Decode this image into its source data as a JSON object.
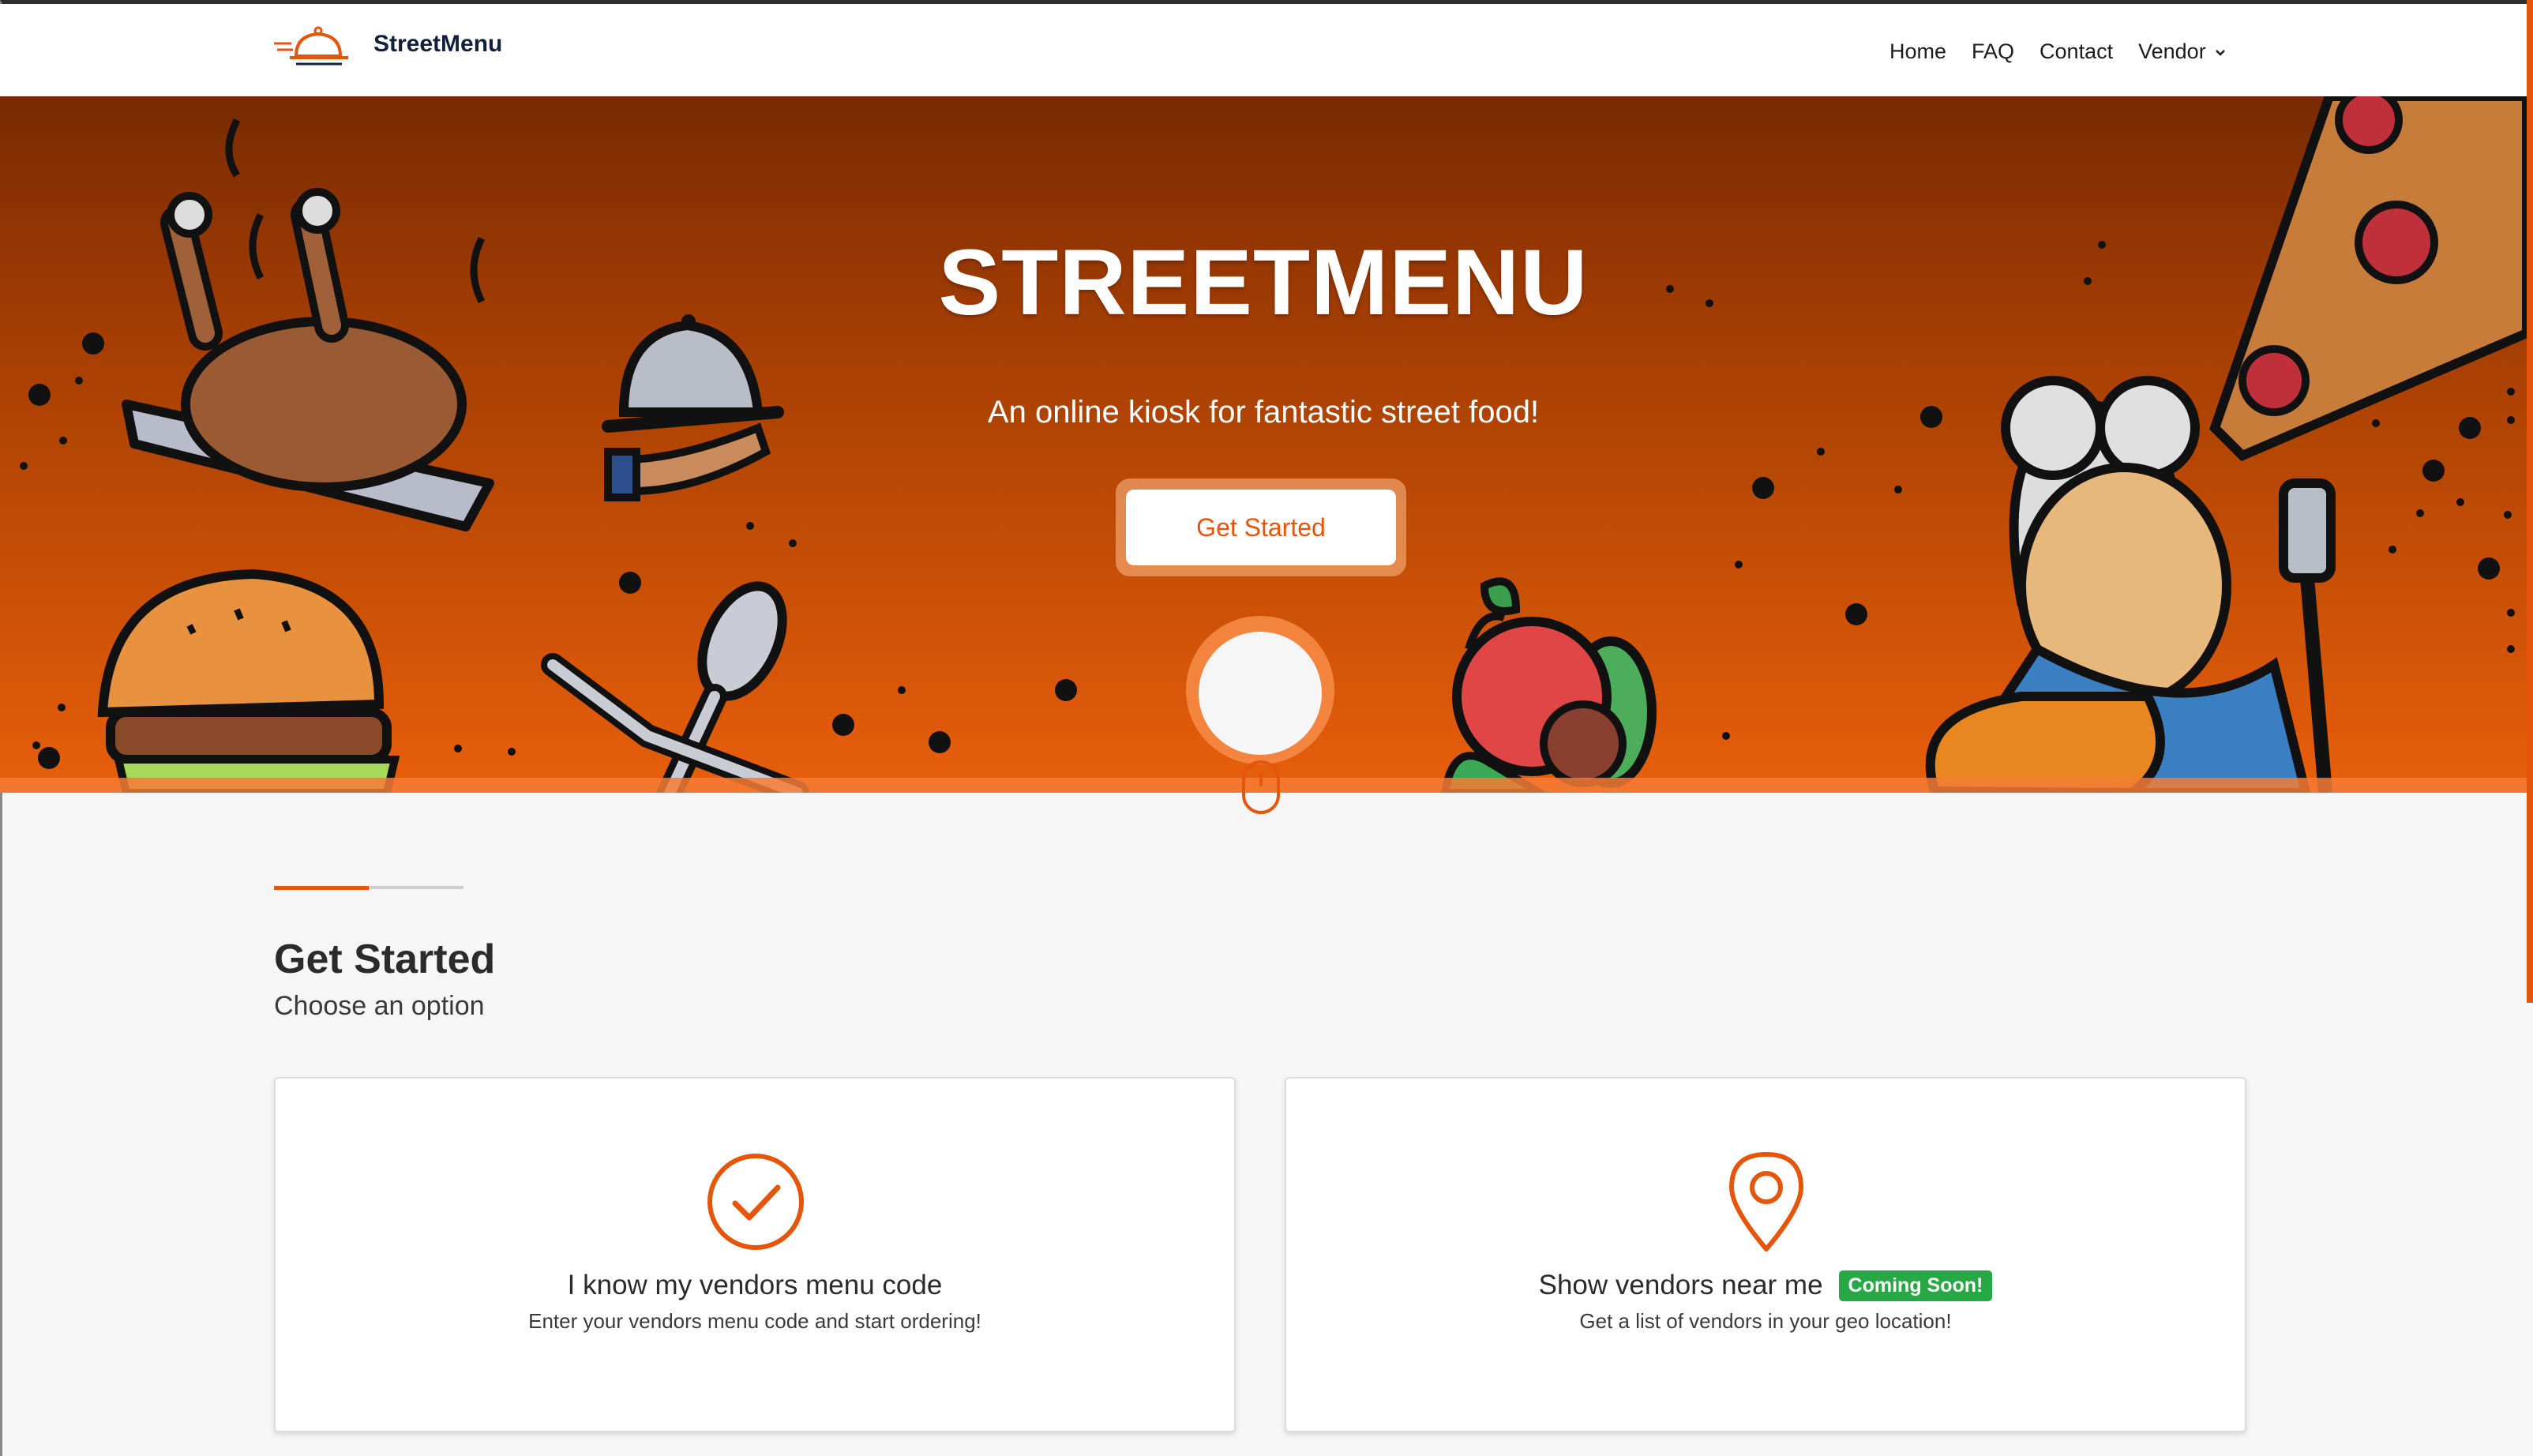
{
  "navbar": {
    "brand": "StreetMenu",
    "links": [
      "Home",
      "FAQ",
      "Contact"
    ],
    "vendor_label": "Vendor"
  },
  "hero": {
    "title": "STREETMENU",
    "subtitle": "An online kiosk for fantastic street food!",
    "cta_label": "Get Started"
  },
  "section": {
    "title": "Get Started",
    "subtitle": "Choose an option"
  },
  "cards": [
    {
      "title": "I know my vendors menu code",
      "description": "Enter your vendors menu code and start ordering!",
      "icon": "check-circle-icon"
    },
    {
      "title": "Show vendors near me",
      "badge": "Coming Soon!",
      "description": "Get a list of vendors in your geo location!",
      "icon": "map-pin-icon"
    }
  ],
  "colors": {
    "accent": "#e4560c",
    "badge": "#27a844",
    "brand_text": "#12203a"
  }
}
